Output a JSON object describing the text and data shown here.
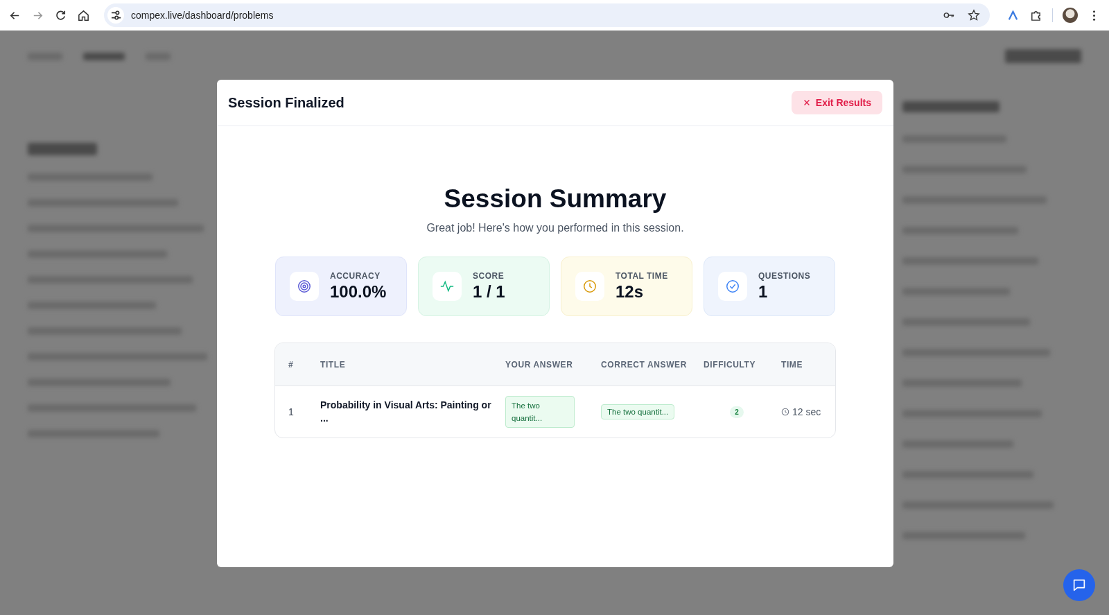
{
  "browser": {
    "url": "compex.live/dashboard/problems"
  },
  "modal": {
    "title": "Session Finalized",
    "exit_button": "Exit Results",
    "heading": "Session Summary",
    "subtitle": "Great job! Here's how you performed in this session.",
    "stats": [
      {
        "kind": "accuracy",
        "label": "ACCURACY",
        "value": "100.0%"
      },
      {
        "kind": "score",
        "label": "SCORE",
        "value": "1 / 1"
      },
      {
        "kind": "time",
        "label": "TOTAL TIME",
        "value": "12s"
      },
      {
        "kind": "questions",
        "label": "QUESTIONS",
        "value": "1"
      }
    ],
    "table": {
      "columns": [
        "#",
        "TITLE",
        "YOUR ANSWER",
        "CORRECT ANSWER",
        "DIFFICULTY",
        "TIME"
      ],
      "rows": [
        {
          "number": "1",
          "title": "Probability in Visual Arts: Painting or ...",
          "your_answer": "The two quantit...",
          "correct_answer": "The two quantit...",
          "difficulty": "2",
          "time": "12 sec"
        }
      ]
    }
  }
}
